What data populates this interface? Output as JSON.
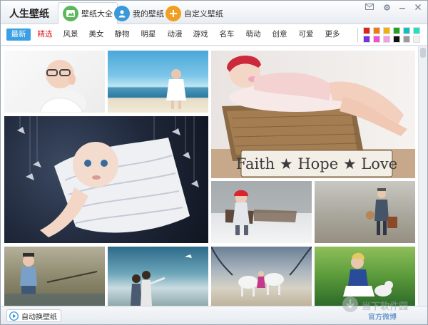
{
  "app": {
    "title": "人生壁纸",
    "tabs": [
      {
        "label": "壁纸大全",
        "icon": "picture-icon",
        "color": "#5cb85c",
        "active": true
      },
      {
        "label": "我的壁纸",
        "icon": "user-icon",
        "color": "#3a9ad9",
        "active": false
      },
      {
        "label": "自定义壁纸",
        "icon": "plus-icon",
        "color": "#f0a020",
        "active": false
      }
    ]
  },
  "categories": [
    {
      "label": "最新",
      "state": "active"
    },
    {
      "label": "精选",
      "state": "featured"
    },
    {
      "label": "风景",
      "state": ""
    },
    {
      "label": "美女",
      "state": ""
    },
    {
      "label": "静物",
      "state": ""
    },
    {
      "label": "明星",
      "state": ""
    },
    {
      "label": "动漫",
      "state": ""
    },
    {
      "label": "游戏",
      "state": ""
    },
    {
      "label": "名车",
      "state": ""
    },
    {
      "label": "萌动",
      "state": ""
    },
    {
      "label": "创意",
      "state": ""
    },
    {
      "label": "可爱",
      "state": ""
    },
    {
      "label": "更多",
      "state": ""
    }
  ],
  "swatches": [
    "#e02020",
    "#f07a10",
    "#f0b010",
    "#20a020",
    "#10c0c0",
    "#20e0c0",
    "#7a30e0",
    "#f050d0",
    "#f0a0e0",
    "#101010",
    "#9a9a9a",
    "#f0f0f0"
  ],
  "photo_sign": "Faith ★ Hope ★ Love",
  "status": {
    "auto_label": "自动换壁纸",
    "right_label": "官方微博"
  },
  "watermark": "当下软件园"
}
